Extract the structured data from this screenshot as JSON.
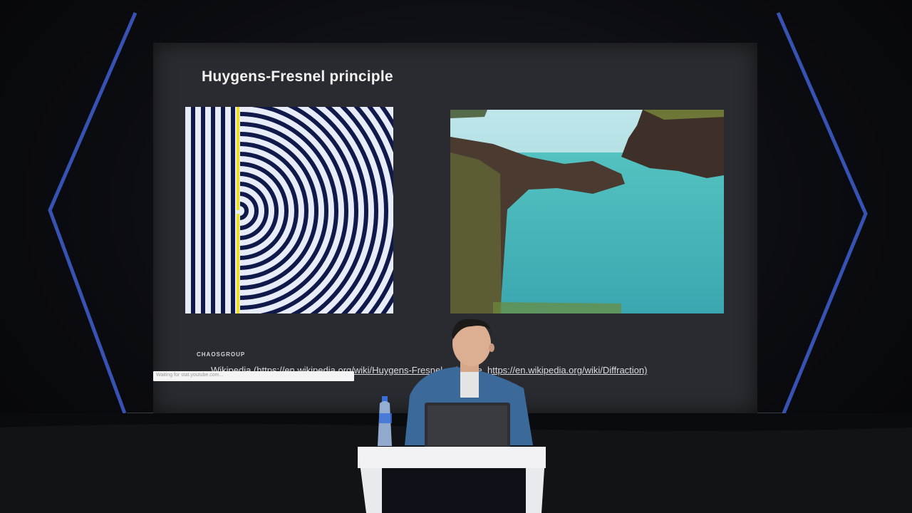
{
  "slide": {
    "title": "Huygens-Fresnel principle",
    "logo_text": "CHAOSGROUP",
    "source_text": "Wikipedia (https://en.wikipedia.org/wiki/Huygens-Fresnel_principle, https://en.wikipedia.org/wiki/Diffraction)"
  },
  "overlay": {
    "video_bar_text": "Waiting for stat.youtube.com..."
  },
  "colors": {
    "stage_frame": "#3f5fd0",
    "screen": "#2a2b30",
    "wave_dark": "#101a4a",
    "wave_light": "#e8ecf8",
    "barrier": "#f0e020",
    "water": "#3fb8b4",
    "shirt": "#3b6a9a"
  },
  "icons": {
    "bottle": "water-bottle-icon",
    "laptop": "laptop-icon"
  }
}
